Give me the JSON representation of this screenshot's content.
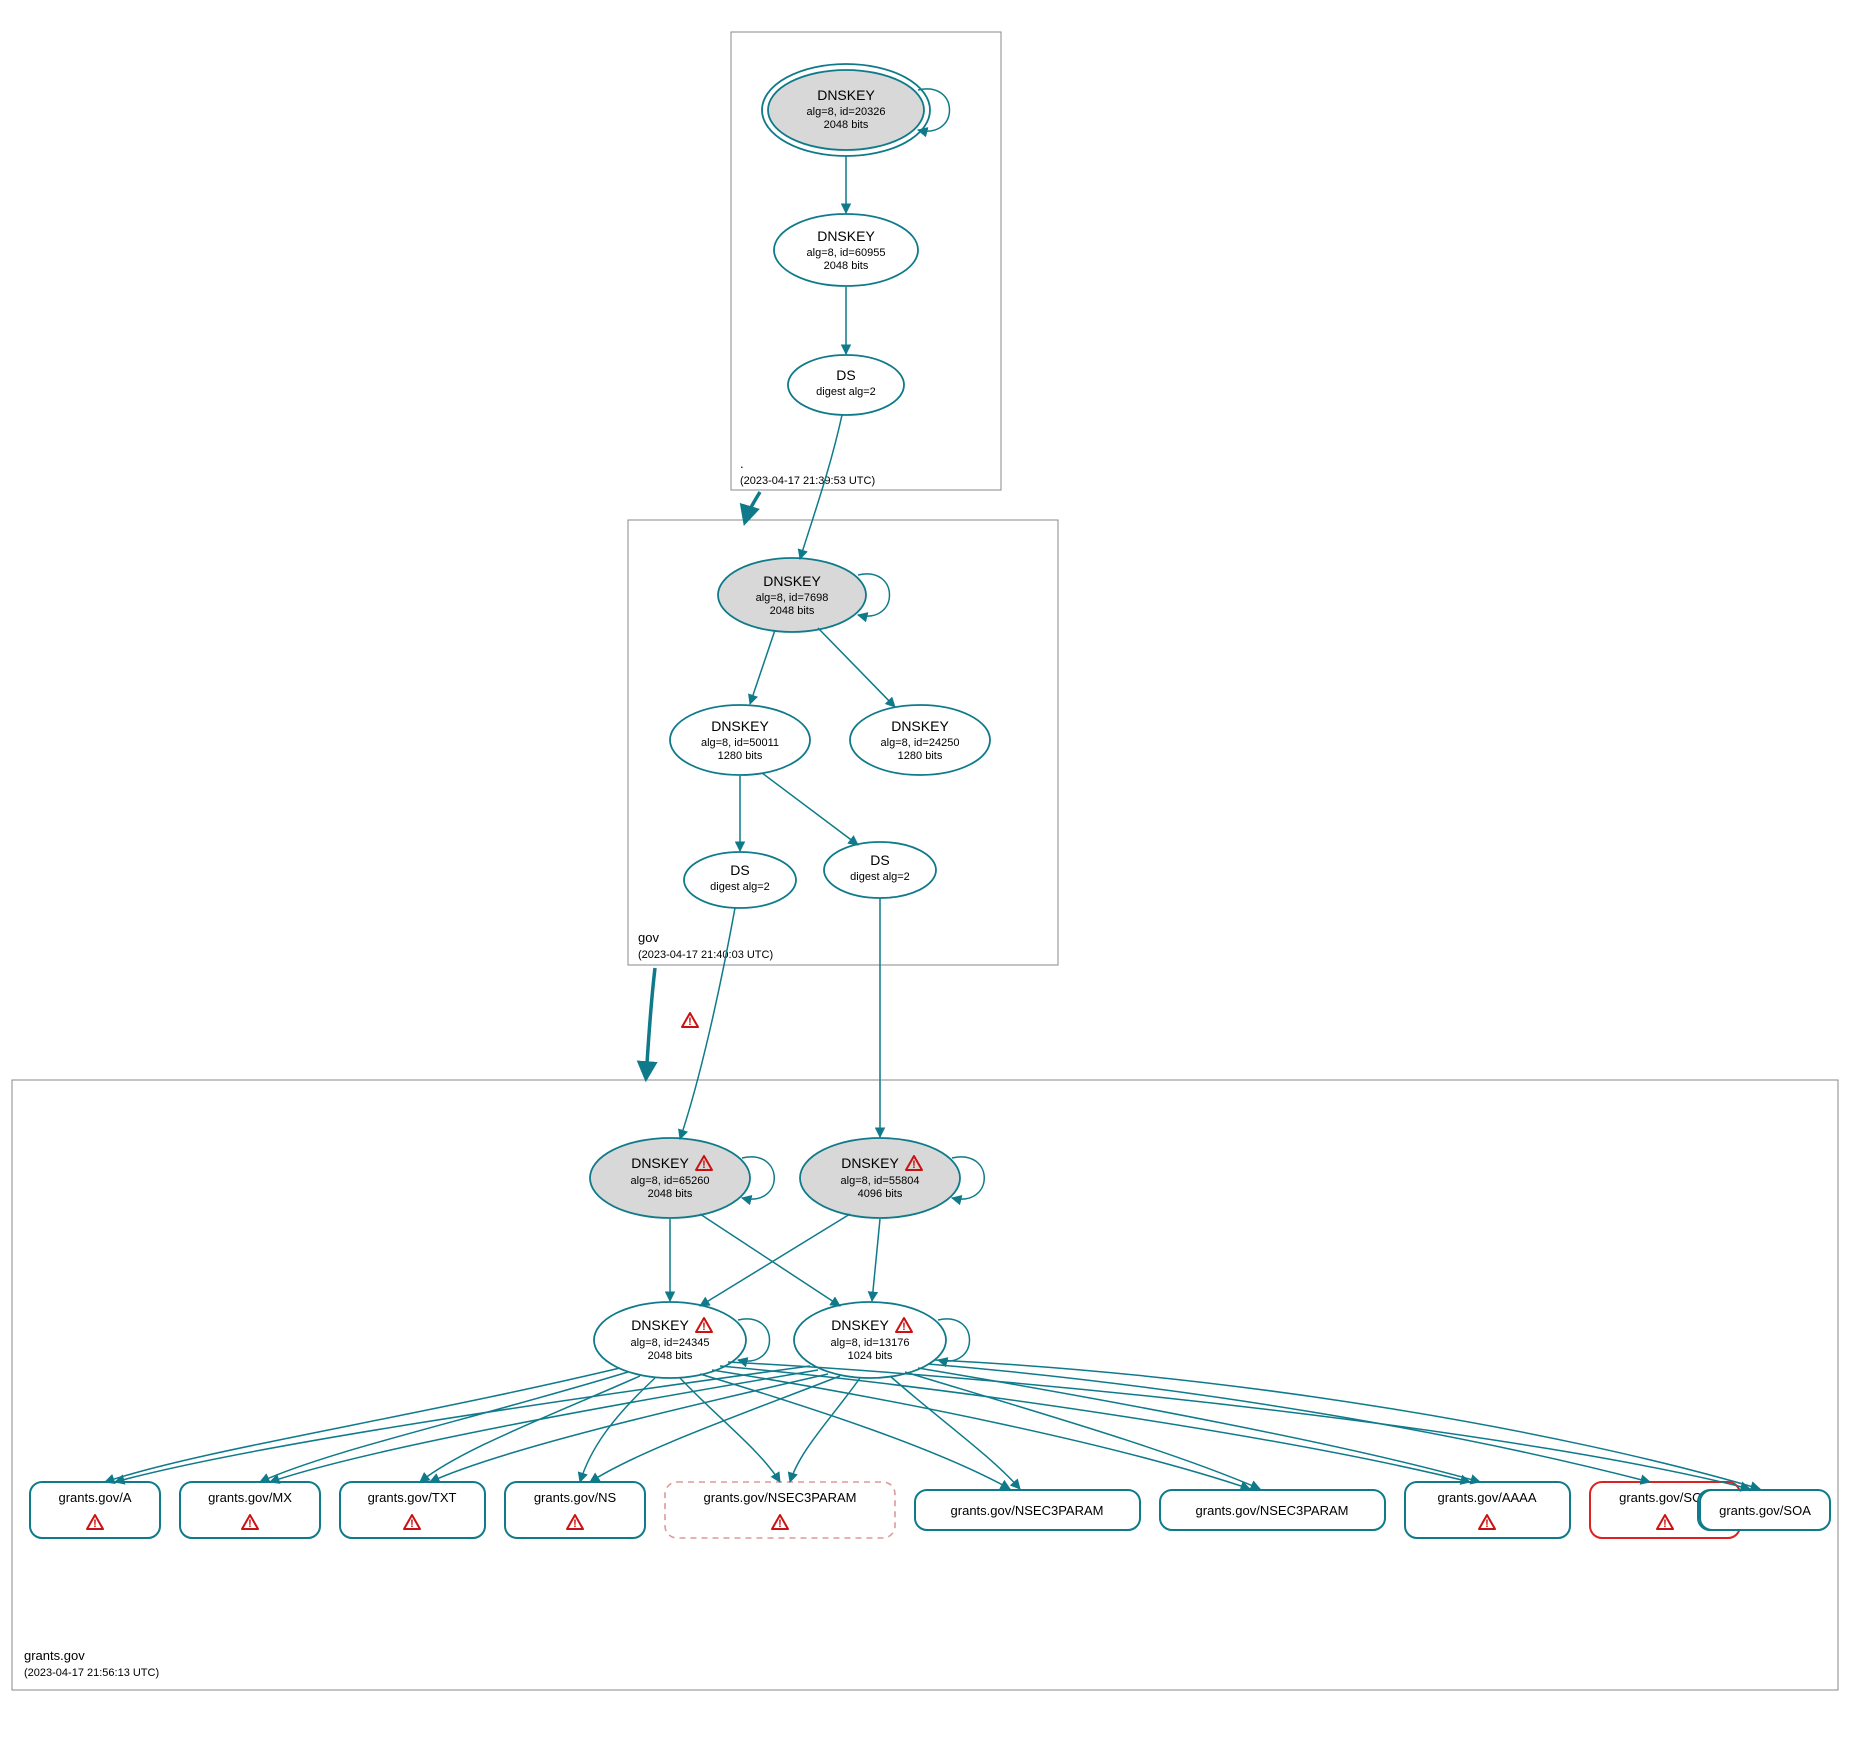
{
  "colors": {
    "teal": "#0e7a8a",
    "red": "#d22",
    "grey_fill": "#d8d8d8"
  },
  "zones": {
    "root": {
      "name": ".",
      "timestamp": "(2023-04-17 21:39:53 UTC)"
    },
    "gov": {
      "name": "gov",
      "timestamp": "(2023-04-17 21:40:03 UTC)"
    },
    "grants": {
      "name": "grants.gov",
      "timestamp": "(2023-04-17 21:56:13 UTC)"
    }
  },
  "nodes": {
    "root_ksk": {
      "title": "DNSKEY",
      "l1": "alg=8, id=20326",
      "l2": "2048 bits"
    },
    "root_zsk": {
      "title": "DNSKEY",
      "l1": "alg=8, id=60955",
      "l2": "2048 bits"
    },
    "root_ds": {
      "title": "DS",
      "l1": "digest alg=2"
    },
    "gov_ksk": {
      "title": "DNSKEY",
      "l1": "alg=8, id=7698",
      "l2": "2048 bits"
    },
    "gov_zsk1": {
      "title": "DNSKEY",
      "l1": "alg=8, id=50011",
      "l2": "1280 bits"
    },
    "gov_zsk2": {
      "title": "DNSKEY",
      "l1": "alg=8, id=24250",
      "l2": "1280 bits"
    },
    "gov_ds1": {
      "title": "DS",
      "l1": "digest alg=2"
    },
    "gov_ds2": {
      "title": "DS",
      "l1": "digest alg=2"
    },
    "gr_ksk1": {
      "title": "DNSKEY",
      "l1": "alg=8, id=65260",
      "l2": "2048 bits"
    },
    "gr_ksk2": {
      "title": "DNSKEY",
      "l1": "alg=8, id=55804",
      "l2": "4096 bits"
    },
    "gr_zsk1": {
      "title": "DNSKEY",
      "l1": "alg=8, id=24345",
      "l2": "2048 bits"
    },
    "gr_zsk2": {
      "title": "DNSKEY",
      "l1": "alg=8, id=13176",
      "l2": "1024 bits"
    }
  },
  "rrsets": {
    "a": {
      "label": "grants.gov/A"
    },
    "mx": {
      "label": "grants.gov/MX"
    },
    "txt": {
      "label": "grants.gov/TXT"
    },
    "ns": {
      "label": "grants.gov/NS"
    },
    "n3p1": {
      "label": "grants.gov/NSEC3PARAM"
    },
    "n3p2": {
      "label": "grants.gov/NSEC3PARAM"
    },
    "n3p3": {
      "label": "grants.gov/NSEC3PARAM"
    },
    "aaaa": {
      "label": "grants.gov/AAAA"
    },
    "soa1": {
      "label": "grants.gov/SOA"
    },
    "soa2": {
      "label": "grants.gov/SOA"
    }
  }
}
